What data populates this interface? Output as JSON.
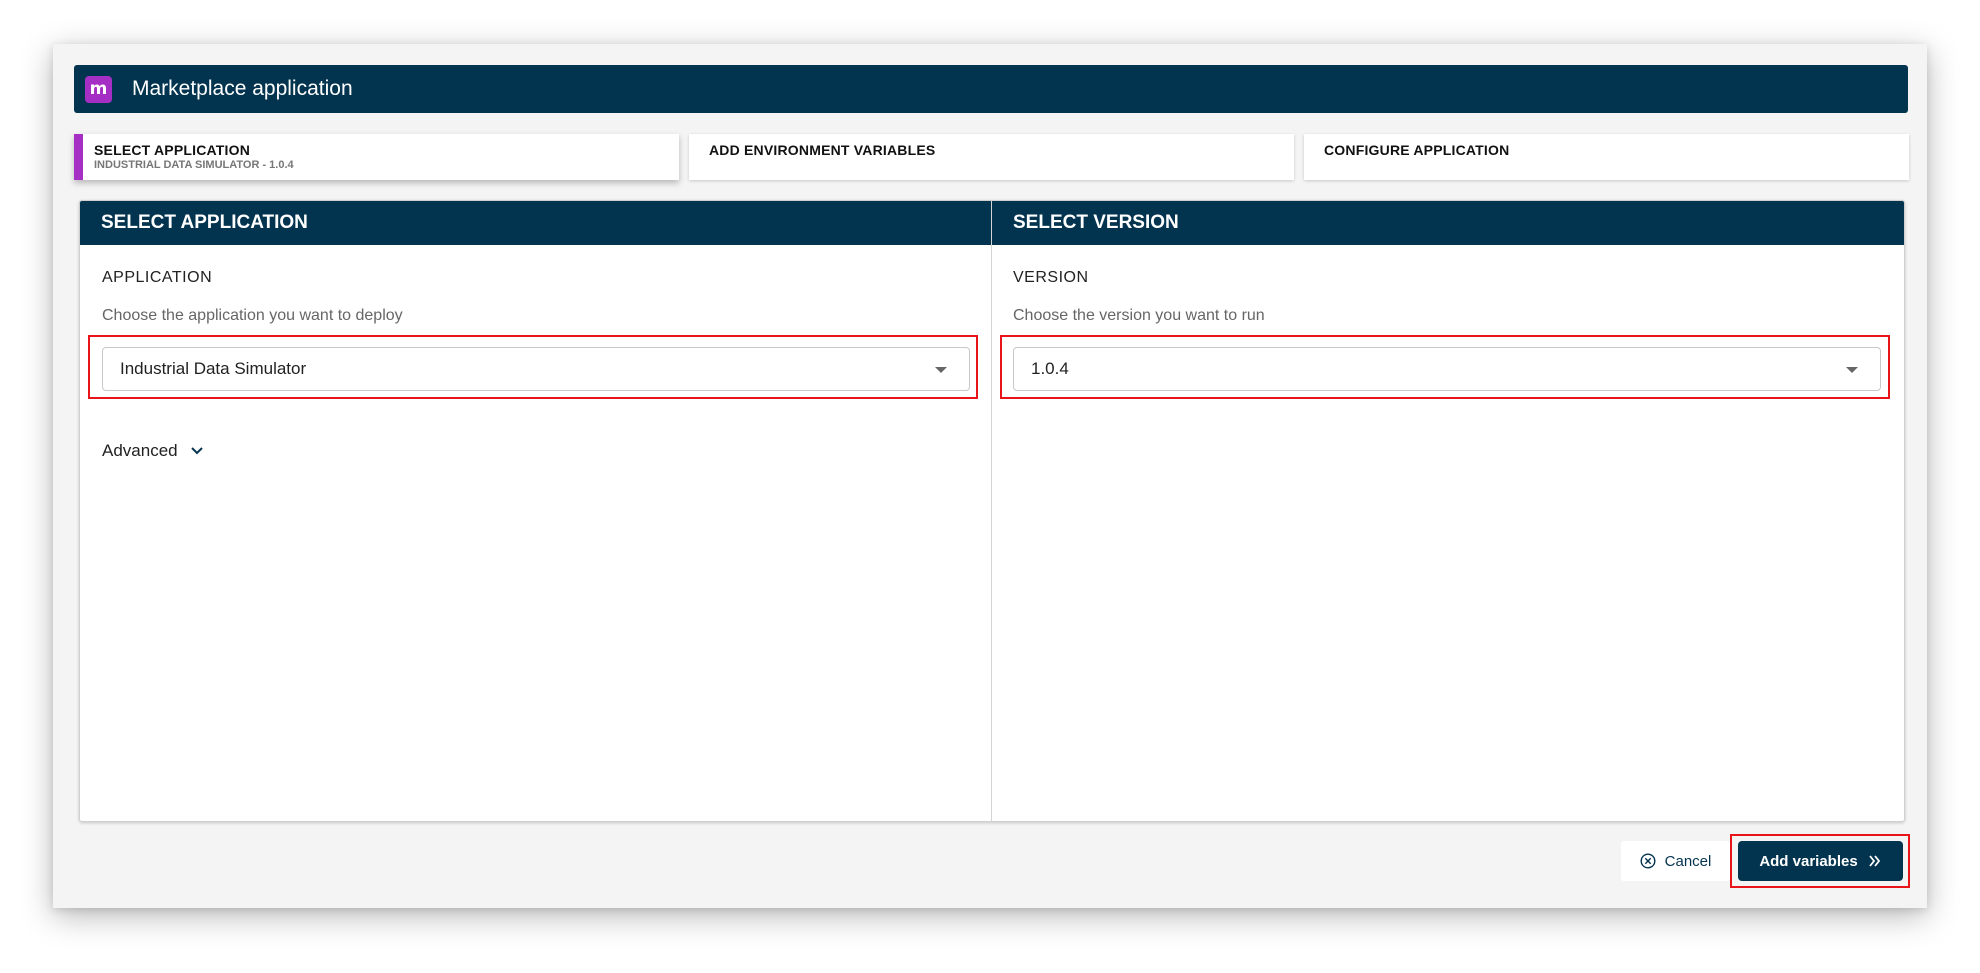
{
  "dialog": {
    "title": "Marketplace application",
    "logo_letter": "m",
    "logo_color": "#a52fc4",
    "header_color": "#03344f"
  },
  "steps": [
    {
      "title": "SELECT APPLICATION",
      "subtitle": "INDUSTRIAL DATA SIMULATOR - 1.0.4",
      "active": true
    },
    {
      "title": "ADD ENVIRONMENT VARIABLES",
      "subtitle": "",
      "active": false
    },
    {
      "title": "CONFIGURE APPLICATION",
      "subtitle": "",
      "active": false
    }
  ],
  "left_panel": {
    "header": "SELECT APPLICATION",
    "label": "APPLICATION",
    "hint": "Choose the application you want to deploy",
    "selected": "Industrial Data Simulator",
    "advanced": "Advanced"
  },
  "right_panel": {
    "header": "SELECT VERSION",
    "label": "VERSION",
    "hint": "Choose the version you want to run",
    "selected": "1.0.4"
  },
  "footer": {
    "cancel": "Cancel",
    "primary": "Add variables"
  },
  "icons": {
    "cancel": "circle-x-icon",
    "primary": "double-chevron-right-icon",
    "advanced": "chevron-down-icon",
    "dropdown": "caret-down-icon"
  },
  "highlight_color": "#e8141a"
}
